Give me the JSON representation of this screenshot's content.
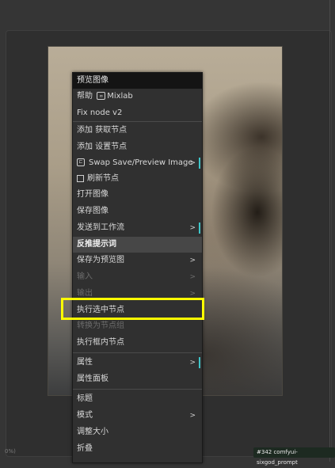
{
  "menu": {
    "title": "预览图像",
    "help_label": "帮助",
    "mixlab_label": "Mixlab",
    "fix_node": "Fix node v2",
    "add_get_node": "添加 获取节点",
    "add_set_node": "添加 设置节点",
    "swap_save": "Swap Save/Preview Image",
    "refresh_node": "刷新节点",
    "open_image": "打开图像",
    "save_image": "保存图像",
    "send_to_workflow": "发送到工作流",
    "reverse_prompt": "反推提示词",
    "save_as_preview": "保存为预览图",
    "input": "输入",
    "output": "输出",
    "execute_selected": "执行选中节点",
    "convert_to_group": "转换为节点组",
    "execute_in_frame": "执行框内节点",
    "properties": "属性",
    "properties_panel": "属性面板",
    "title_item": "标题",
    "mode": "模式",
    "resize": "调整大小",
    "collapse": "折叠",
    "submenu_arrow": ">"
  },
  "status": {
    "node_label": "#342 comfyui-sixgod_prompt",
    "left_text": "0%)"
  },
  "colors": {
    "highlight_box": "#ffff00",
    "accent_bar": "#3fc5c8"
  }
}
